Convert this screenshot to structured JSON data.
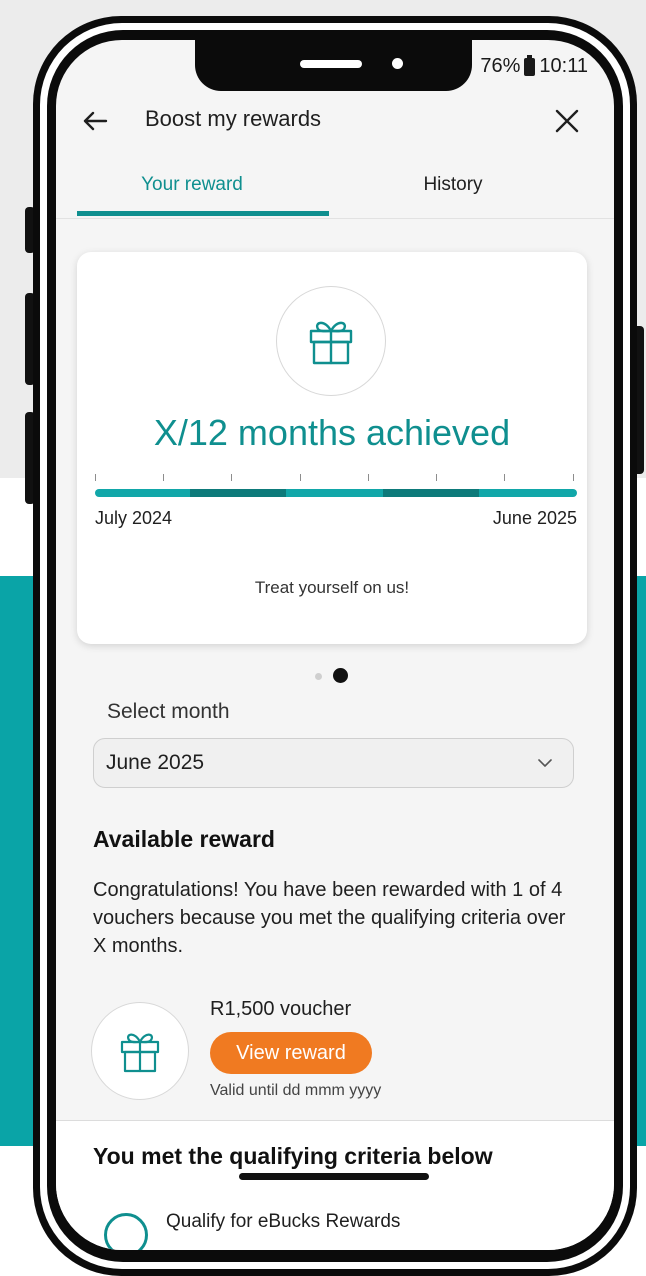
{
  "status_bar": {
    "battery": "76%",
    "time": "10:11"
  },
  "header": {
    "title": "Boost my rewards"
  },
  "tabs": [
    {
      "label": "Your reward",
      "active": true
    },
    {
      "label": "History",
      "active": false
    }
  ],
  "reward_card": {
    "headline": "X/12 months achieved",
    "range_start": "July 2024",
    "range_end": "June 2025",
    "tagline": "Treat yourself on us!"
  },
  "carousel": {
    "pages": 2,
    "active_page": 2
  },
  "month_select": {
    "label": "Select month",
    "value": "June 2025"
  },
  "available_reward": {
    "title": "Available reward",
    "body": "Congratulations! You have been rewarded with 1 of 4 vouchers because you met the qualifying criteria over X months.",
    "voucher_name": "R1,500 voucher",
    "button_label": "View reward",
    "valid_text": "Valid until dd mmm yyyy"
  },
  "criteria": {
    "title": "You met the qualifying criteria below",
    "first_item": "Qualify for eBucks Rewards"
  },
  "colors": {
    "accent": "#0f8f8f",
    "brand_teal": "#0aa4a7",
    "button_orange": "#f07a21"
  }
}
